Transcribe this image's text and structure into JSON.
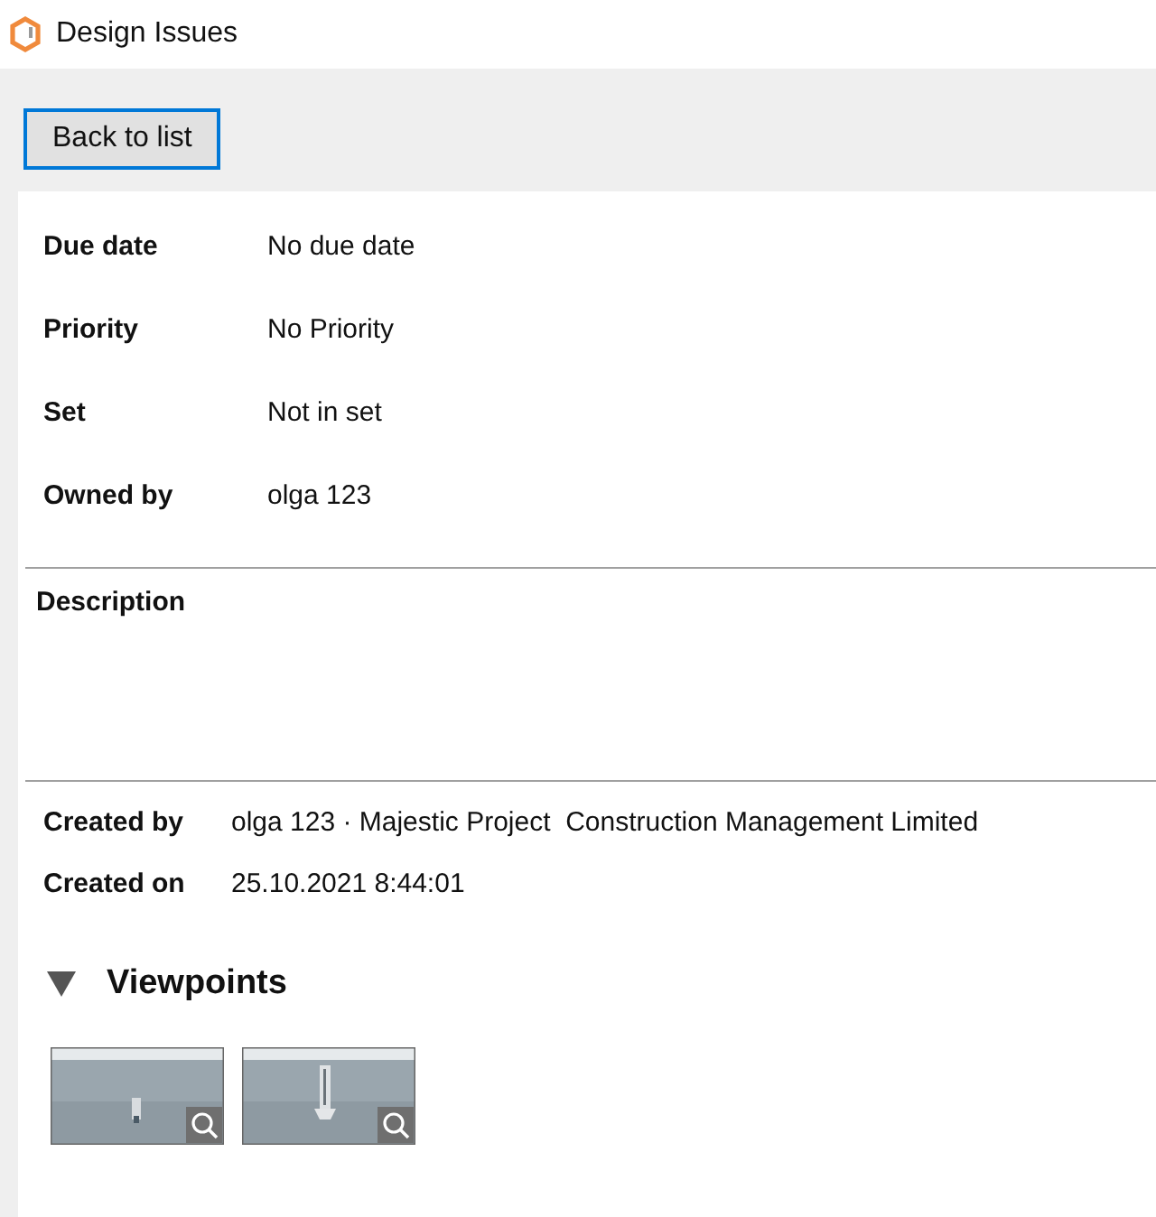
{
  "window": {
    "title": "Design Issues"
  },
  "back_button": "Back to list",
  "fields": [
    {
      "label": "Due date",
      "value": "No due date"
    },
    {
      "label": "Priority",
      "value": "No Priority"
    },
    {
      "label": "Set",
      "value": "Not in set"
    },
    {
      "label": "Owned by",
      "value": "olga 123"
    }
  ],
  "description": {
    "label": "Description"
  },
  "meta": [
    {
      "label": "Created by",
      "value": "olga 123 · Majestic Project  Construction Management Limited"
    },
    {
      "label": "Created on",
      "value": "25.10.2021 8:44:01"
    }
  ],
  "viewpoints": {
    "title": "Viewpoints",
    "expanded": true
  }
}
